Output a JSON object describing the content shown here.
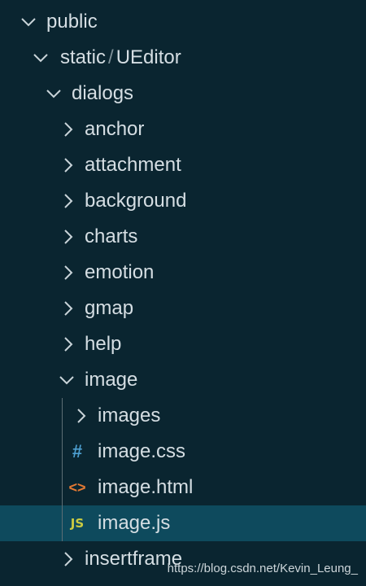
{
  "explorer": {
    "public": "public",
    "static_path": {
      "part1": "static",
      "separator": "/",
      "part2": "UEditor"
    },
    "dialogs": "dialogs",
    "folders": {
      "anchor": "anchor",
      "attachment": "attachment",
      "background": "background",
      "charts": "charts",
      "emotion": "emotion",
      "gmap": "gmap",
      "help": "help",
      "image": "image",
      "insertframe": "insertframe"
    },
    "image_children": {
      "images": "images",
      "image_css": "image.css",
      "image_html": "image.html",
      "image_js": "image.js"
    },
    "file_icons": {
      "css": {
        "glyph": "#",
        "name": "css-file-icon",
        "color": "#4d9fd0"
      },
      "html": {
        "glyph": "<>",
        "name": "html-file-icon",
        "color": "#e37933"
      },
      "js": {
        "glyph": "JS",
        "name": "js-file-icon",
        "color": "#cbcb41"
      }
    },
    "selected": "image.js"
  },
  "colors": {
    "background": "#0a2530",
    "selected_row": "#0e4a5d",
    "text": "#d5dee3"
  },
  "watermark": "https://blog.csdn.net/Kevin_Leung_"
}
